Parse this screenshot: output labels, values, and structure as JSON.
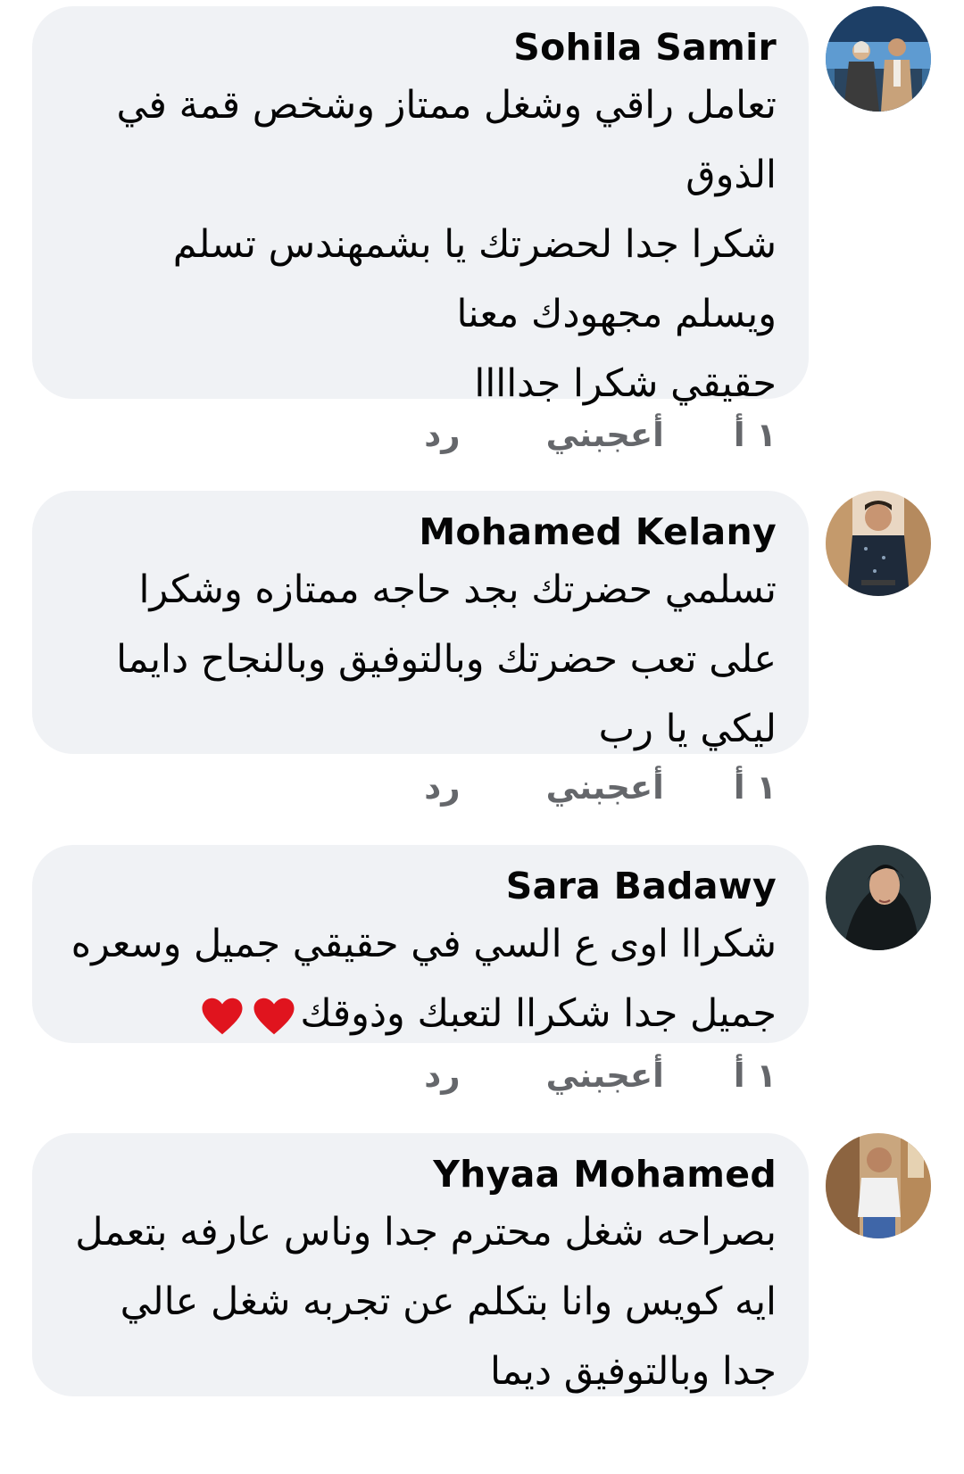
{
  "comments": [
    {
      "author": "Sohila Samir",
      "lines": [
        "تعامل راقي وشغل ممتاز وشخص قمة في",
        "الذوق",
        "شكرا جدا لحضرتك يا بشمهندس تسلم",
        "ويسلم مجهودك معنا",
        "حقيقي شكرا جداااا"
      ],
      "time": "١ أ",
      "like_label": "أعجبني",
      "reply_label": "رد",
      "avatar_icon": "profile-photo"
    },
    {
      "author": "Mohamed Kelany",
      "lines": [
        "تسلمي حضرتك بجد حاجه ممتازه وشكرا",
        "على تعب حضرتك وبالتوفيق وبالنجاح دايما",
        "ليكي يا رب"
      ],
      "time": "١ أ",
      "like_label": "أعجبني",
      "reply_label": "رد",
      "avatar_icon": "profile-photo"
    },
    {
      "author": "Sara Badawy",
      "lines": [
        "شكراا اوى ع السي في حقيقي جميل وسعره",
        "جميل جدا شكراا لتعبك وذوقك"
      ],
      "emoji": "heart-icon x2",
      "time": "١ أ",
      "like_label": "أعجبني",
      "reply_label": "رد",
      "avatar_icon": "profile-photo"
    },
    {
      "author": "Yhyaa Mohamed",
      "lines": [
        "بصراحه شغل محترم جدا وناس عارفه بتعمل",
        "ايه كويس وانا بتكلم عن تجربه شغل عالي",
        "جدا وبالتوفيق ديما"
      ],
      "avatar_icon": "profile-photo"
    }
  ],
  "colors": {
    "bubble_bg": "#f0f2f5",
    "text": "#050505",
    "meta_text": "#65676b",
    "heart": "#e0141e"
  }
}
